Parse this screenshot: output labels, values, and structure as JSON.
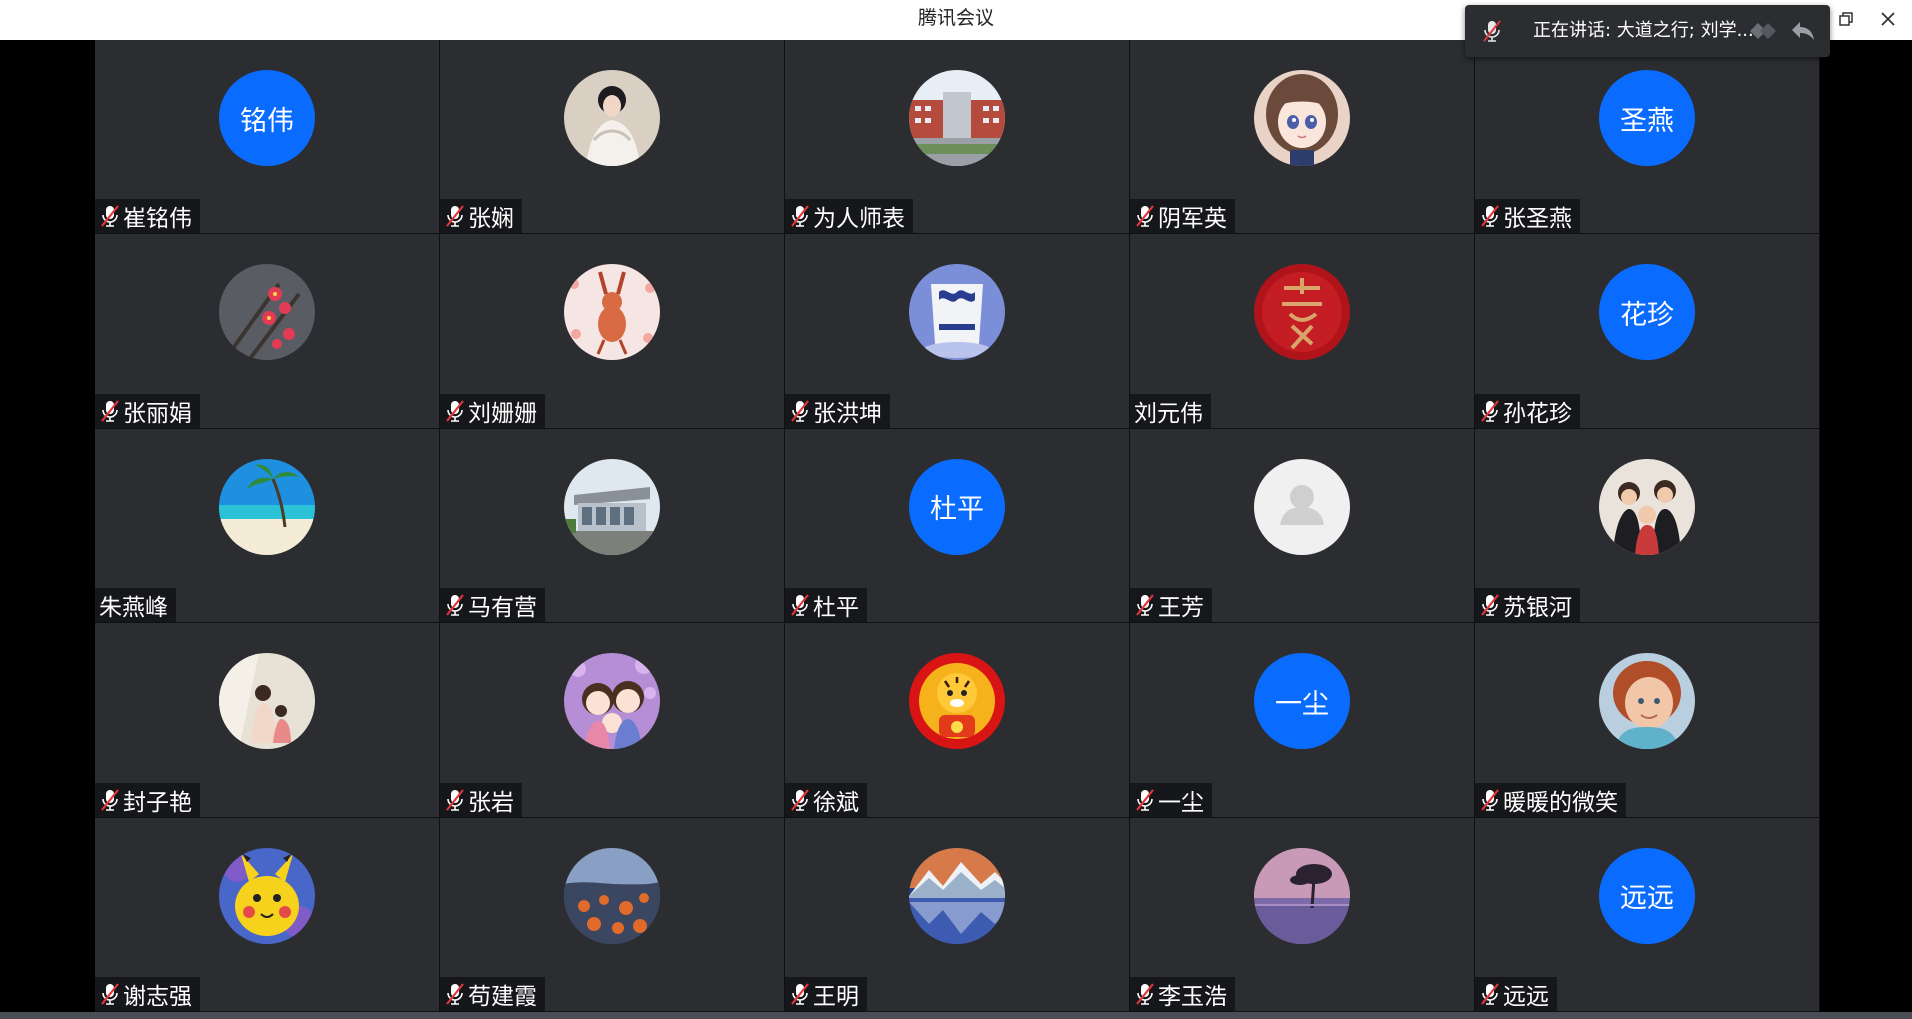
{
  "window": {
    "title": "腾讯会议",
    "restore_icon": "restore-icon",
    "close_icon": "close-icon"
  },
  "speaking": {
    "text": "正在讲话: 大道之行; 刘学...",
    "icons": [
      "mic-muted-icon",
      "layout-icon",
      "back-arrow-icon"
    ]
  },
  "participants": [
    {
      "name": "崔铭伟",
      "muted": true,
      "avatar": {
        "type": "text",
        "text": "铭伟",
        "color": "#0a6cff"
      }
    },
    {
      "name": "张娴",
      "muted": true,
      "avatar": {
        "type": "image",
        "icon": "woman-portrait-photo"
      }
    },
    {
      "name": "为人师表",
      "muted": true,
      "avatar": {
        "type": "image",
        "icon": "school-building-photo"
      }
    },
    {
      "name": "阴军英",
      "muted": true,
      "avatar": {
        "type": "image",
        "icon": "anime-girl-photo"
      }
    },
    {
      "name": "张圣燕",
      "muted": true,
      "avatar": {
        "type": "text",
        "text": "圣燕",
        "color": "#0a6cff"
      }
    },
    {
      "name": "张丽娟",
      "muted": true,
      "avatar": {
        "type": "image",
        "icon": "red-flowers-photo"
      }
    },
    {
      "name": "刘姗姗",
      "muted": true,
      "avatar": {
        "type": "image",
        "icon": "rabbit-drawing-photo"
      }
    },
    {
      "name": "张洪坤",
      "muted": true,
      "avatar": {
        "type": "image",
        "icon": "porcelain-cup-photo"
      }
    },
    {
      "name": "刘元伟",
      "muted": false,
      "avatar": {
        "type": "image",
        "icon": "red-calligraphy-photo"
      }
    },
    {
      "name": "孙花珍",
      "muted": true,
      "avatar": {
        "type": "text",
        "text": "花珍",
        "color": "#0a6cff"
      }
    },
    {
      "name": "朱燕峰",
      "muted": false,
      "avatar": {
        "type": "image",
        "icon": "beach-palm-photo"
      }
    },
    {
      "name": "马有营",
      "muted": true,
      "avatar": {
        "type": "image",
        "icon": "building-photo"
      }
    },
    {
      "name": "杜平",
      "muted": true,
      "avatar": {
        "type": "text",
        "text": "杜平",
        "color": "#0a6cff"
      }
    },
    {
      "name": "王芳",
      "muted": true,
      "avatar": {
        "type": "default",
        "icon": "default-user-icon"
      }
    },
    {
      "name": "苏银河",
      "muted": true,
      "avatar": {
        "type": "image",
        "icon": "family-photo"
      }
    },
    {
      "name": "封子艳",
      "muted": true,
      "avatar": {
        "type": "image",
        "icon": "mother-child-photo"
      }
    },
    {
      "name": "张岩",
      "muted": true,
      "avatar": {
        "type": "image",
        "icon": "cartoon-family-photo"
      }
    },
    {
      "name": "徐斌",
      "muted": true,
      "avatar": {
        "type": "image",
        "icon": "tiger-cartoon-photo"
      }
    },
    {
      "name": "一尘",
      "muted": true,
      "avatar": {
        "type": "text",
        "text": "一尘",
        "color": "#0a6cff"
      }
    },
    {
      "name": "暖暖的微笑",
      "muted": true,
      "avatar": {
        "type": "image",
        "icon": "child-portrait-photo"
      }
    },
    {
      "name": "谢志强",
      "muted": true,
      "avatar": {
        "type": "image",
        "icon": "pikachu-photo"
      }
    },
    {
      "name": "苟建霞",
      "muted": true,
      "avatar": {
        "type": "image",
        "icon": "coast-sunset-photo"
      }
    },
    {
      "name": "王明",
      "muted": true,
      "avatar": {
        "type": "image",
        "icon": "mountain-lake-photo"
      }
    },
    {
      "name": "李玉浩",
      "muted": true,
      "avatar": {
        "type": "image",
        "icon": "tree-sunset-photo"
      }
    },
    {
      "name": "远远",
      "muted": true,
      "avatar": {
        "type": "text",
        "text": "远远",
        "color": "#0a6cff"
      }
    }
  ]
}
